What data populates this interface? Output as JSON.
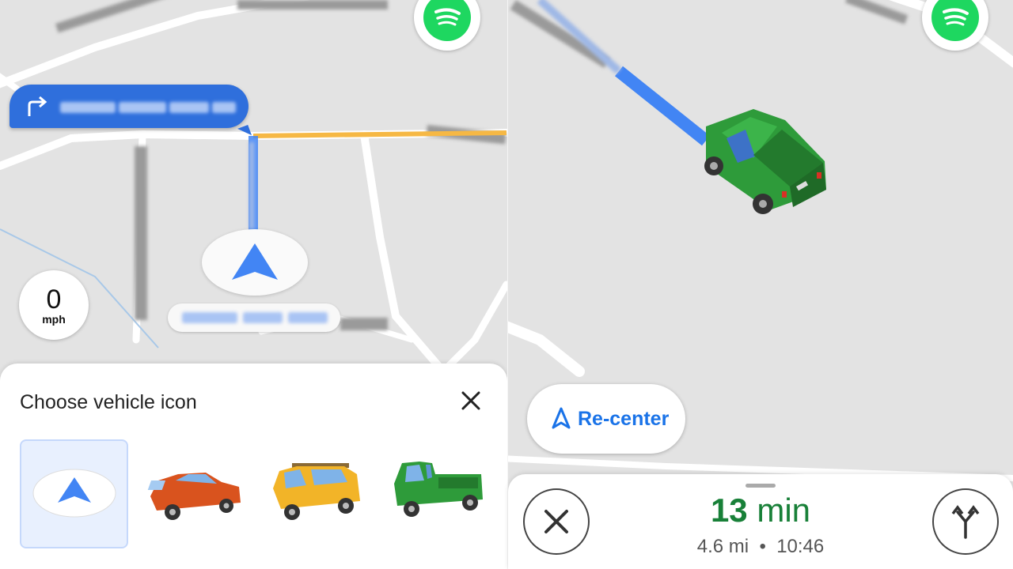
{
  "left_panel": {
    "speed": {
      "value": "0",
      "unit": "mph"
    },
    "vehicle_sheet": {
      "title": "Choose vehicle icon",
      "options": [
        {
          "name": "navigation-arrow",
          "selected": true
        },
        {
          "name": "orange-car",
          "selected": false
        },
        {
          "name": "yellow-suv",
          "selected": false
        },
        {
          "name": "green-pickup",
          "selected": false
        }
      ]
    },
    "colors": {
      "route": "#4285f4",
      "turn_banner": "#2f6fdc",
      "traffic": "#f6b844"
    }
  },
  "right_panel": {
    "recenter_label": "Re-center",
    "trip": {
      "eta_number": "13",
      "eta_unit": "min",
      "distance": "4.6 mi",
      "separator": "•",
      "arrival_time": "10:46"
    },
    "colors": {
      "eta": "#188038",
      "accent": "#1a73e8",
      "vehicle": "#2e9b3a"
    }
  },
  "icons": [
    "turn-right-icon",
    "spotify-icon",
    "close-icon",
    "navigation-arrow-icon",
    "alternate-routes-icon"
  ]
}
